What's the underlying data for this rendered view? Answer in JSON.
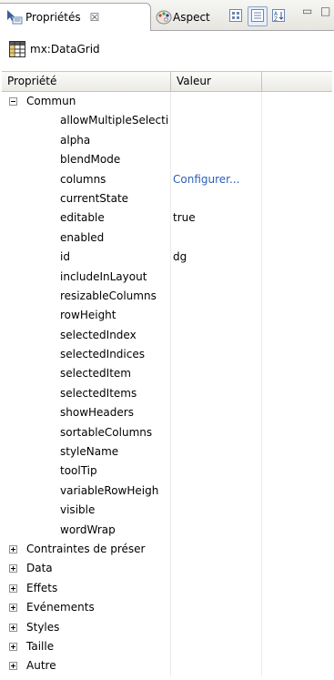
{
  "tabs": {
    "active_label": "Propriétés",
    "inactive_label": "Aspect",
    "close_glyph": "☒"
  },
  "window_buttons": {
    "minimize": "▭",
    "maximize": "□"
  },
  "component": {
    "name": "mx:DataGrid"
  },
  "grid": {
    "headers": {
      "property": "Propriété",
      "value": "Valeur"
    },
    "group_open": {
      "label": "Commun"
    },
    "properties": [
      {
        "name": "allowMultipleSelecti",
        "value": ""
      },
      {
        "name": "alpha",
        "value": ""
      },
      {
        "name": "blendMode",
        "value": ""
      },
      {
        "name": "columns",
        "value": "Configurer..."
      },
      {
        "name": "currentState",
        "value": ""
      },
      {
        "name": "editable",
        "value": "true"
      },
      {
        "name": "enabled",
        "value": ""
      },
      {
        "name": "id",
        "value": "dg"
      },
      {
        "name": "includeInLayout",
        "value": ""
      },
      {
        "name": "resizableColumns",
        "value": ""
      },
      {
        "name": "rowHeight",
        "value": ""
      },
      {
        "name": "selectedIndex",
        "value": ""
      },
      {
        "name": "selectedIndices",
        "value": ""
      },
      {
        "name": "selectedItem",
        "value": ""
      },
      {
        "name": "selectedItems",
        "value": ""
      },
      {
        "name": "showHeaders",
        "value": ""
      },
      {
        "name": "sortableColumns",
        "value": ""
      },
      {
        "name": "styleName",
        "value": ""
      },
      {
        "name": "toolTip",
        "value": ""
      },
      {
        "name": "variableRowHeigh",
        "value": ""
      },
      {
        "name": "visible",
        "value": ""
      },
      {
        "name": "wordWrap",
        "value": ""
      }
    ],
    "collapsed_groups": [
      {
        "label": "Contraintes de préser"
      },
      {
        "label": "Data"
      },
      {
        "label": "Effets"
      },
      {
        "label": "Evénements"
      },
      {
        "label": "Styles"
      },
      {
        "label": "Taille"
      },
      {
        "label": "Autre"
      }
    ]
  }
}
